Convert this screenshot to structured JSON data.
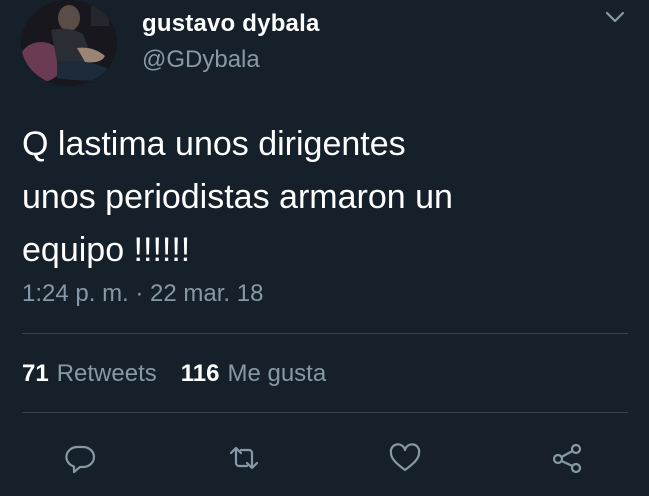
{
  "user": {
    "display_name": "gustavo dybala",
    "handle": "@GDybala"
  },
  "tweet": {
    "text": "Q lastima unos dirigentes\nunos periodistas armaron un\nequipo !!!!!!",
    "timestamp": "1:24 p. m. · 22 mar. 18"
  },
  "stats": {
    "retweets_count": "71",
    "retweets_label": "Retweets",
    "likes_count": "116",
    "likes_label": "Me gusta"
  },
  "actions": [
    "reply-icon",
    "retweet-icon",
    "like-icon",
    "share-icon"
  ],
  "colors": {
    "background": "#15202b",
    "primary_text": "#ffffff",
    "secondary_text": "#8899a6",
    "divider": "#38444d"
  }
}
